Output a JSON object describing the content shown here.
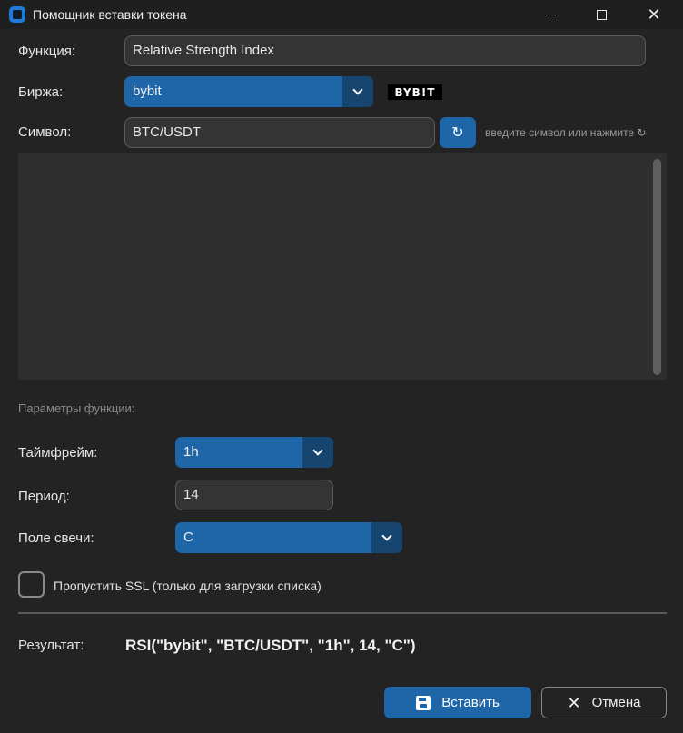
{
  "window": {
    "title": "Помощник вставки токена",
    "minimize_icon": "minimize-icon",
    "maximize_icon": "maximize-icon",
    "close_glyph": "✕"
  },
  "form": {
    "function_label": "Функция:",
    "function_value": "Relative Strength Index",
    "exchange_label": "Биржа:",
    "exchange_value": "bybit",
    "exchange_logo_text": "BYB!T",
    "symbol_label": "Символ:",
    "symbol_value": "BTC/USDT",
    "refresh_glyph": "↻",
    "symbol_hint": "введите символ или нажмите ↻"
  },
  "params": {
    "section_title": "Параметры функции:",
    "timeframe_label": "Таймфрейм:",
    "timeframe_value": "1h",
    "period_label": "Период:",
    "period_value": "14",
    "candle_label": "Поле свечи:",
    "candle_value": "C"
  },
  "options": {
    "skip_ssl_label": "Пропустить SSL (только для загрузки списка)",
    "skip_ssl_checked": false
  },
  "result": {
    "label": "Результат:",
    "value": "RSI(\"bybit\", \"BTC/USDT\", \"1h\", 14, \"C\")"
  },
  "buttons": {
    "insert_label": "Вставить",
    "cancel_label": "Отмена",
    "cancel_glyph": "✕"
  },
  "colors": {
    "accent": "#1f66a8",
    "background": "#232323",
    "field_bg": "#343434"
  }
}
